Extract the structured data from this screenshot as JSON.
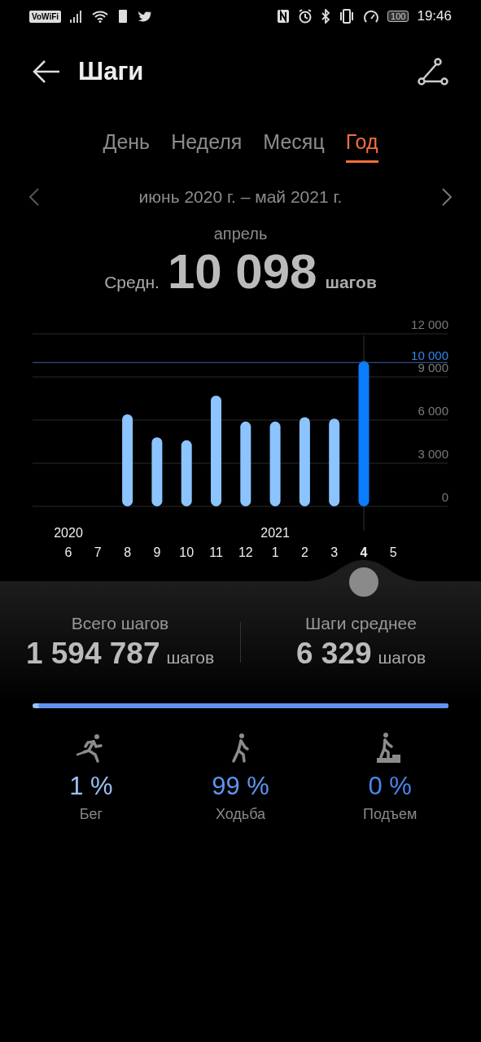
{
  "status_bar": {
    "left_badge": "VoWiFi",
    "battery": "100",
    "time": "19:46"
  },
  "header": {
    "title": "Шаги"
  },
  "tabs": [
    {
      "label": "День",
      "selected": false
    },
    {
      "label": "Неделя",
      "selected": false
    },
    {
      "label": "Месяц",
      "selected": false
    },
    {
      "label": "Год",
      "selected": true
    }
  ],
  "period": {
    "range": "июнь 2020 г. – май 2021 г.",
    "month": "апрель",
    "avg_label": "Средн.",
    "avg_value": "10 098",
    "avg_unit": "шагов"
  },
  "chart_data": {
    "type": "bar",
    "categories": [
      "6",
      "7",
      "8",
      "9",
      "10",
      "11",
      "12",
      "1",
      "2",
      "3",
      "4",
      "5"
    ],
    "values": [
      null,
      null,
      6400,
      4800,
      4600,
      7700,
      5900,
      5900,
      6200,
      6100,
      10100,
      null
    ],
    "ylim": [
      0,
      12000
    ],
    "grid": true,
    "yticks": [
      {
        "value": 0,
        "label": "0"
      },
      {
        "value": 3000,
        "label": "3 000"
      },
      {
        "value": 6000,
        "label": "6 000"
      },
      {
        "value": 9000,
        "label": "9 000"
      },
      {
        "value": 12000,
        "label": "12 000"
      }
    ],
    "ref_lines": [
      {
        "axis": "y",
        "value": 10000,
        "label": "10 000"
      }
    ]
  },
  "month_scale": [
    {
      "year": "2020",
      "selected": false
    },
    {
      "selected": false
    },
    {
      "selected": false
    },
    {
      "selected": false
    },
    {
      "selected": false
    },
    {
      "selected": false
    },
    {
      "selected": false
    },
    {
      "year": "2021",
      "selected": false
    },
    {
      "selected": false
    },
    {
      "selected": false
    },
    {
      "selected": true
    },
    {
      "selected": false
    }
  ],
  "totals": [
    {
      "label": "Всего шагов",
      "value": "1 594 787",
      "unit": "шагов"
    },
    {
      "label": "Шаги среднее",
      "value": "6 329",
      "unit": "шагов"
    }
  ],
  "share_bar": {
    "level": 0.99
  },
  "activities": [
    {
      "kind": "run",
      "value": "1 %",
      "label": "Бег",
      "color": "#9cc0f4"
    },
    {
      "kind": "walk",
      "value": "99 %",
      "label": "Ходьба",
      "color": "#5f95f0"
    },
    {
      "kind": "climb",
      "value": "0 %",
      "label": "Подъем",
      "color": "#4a86ee"
    }
  ]
}
